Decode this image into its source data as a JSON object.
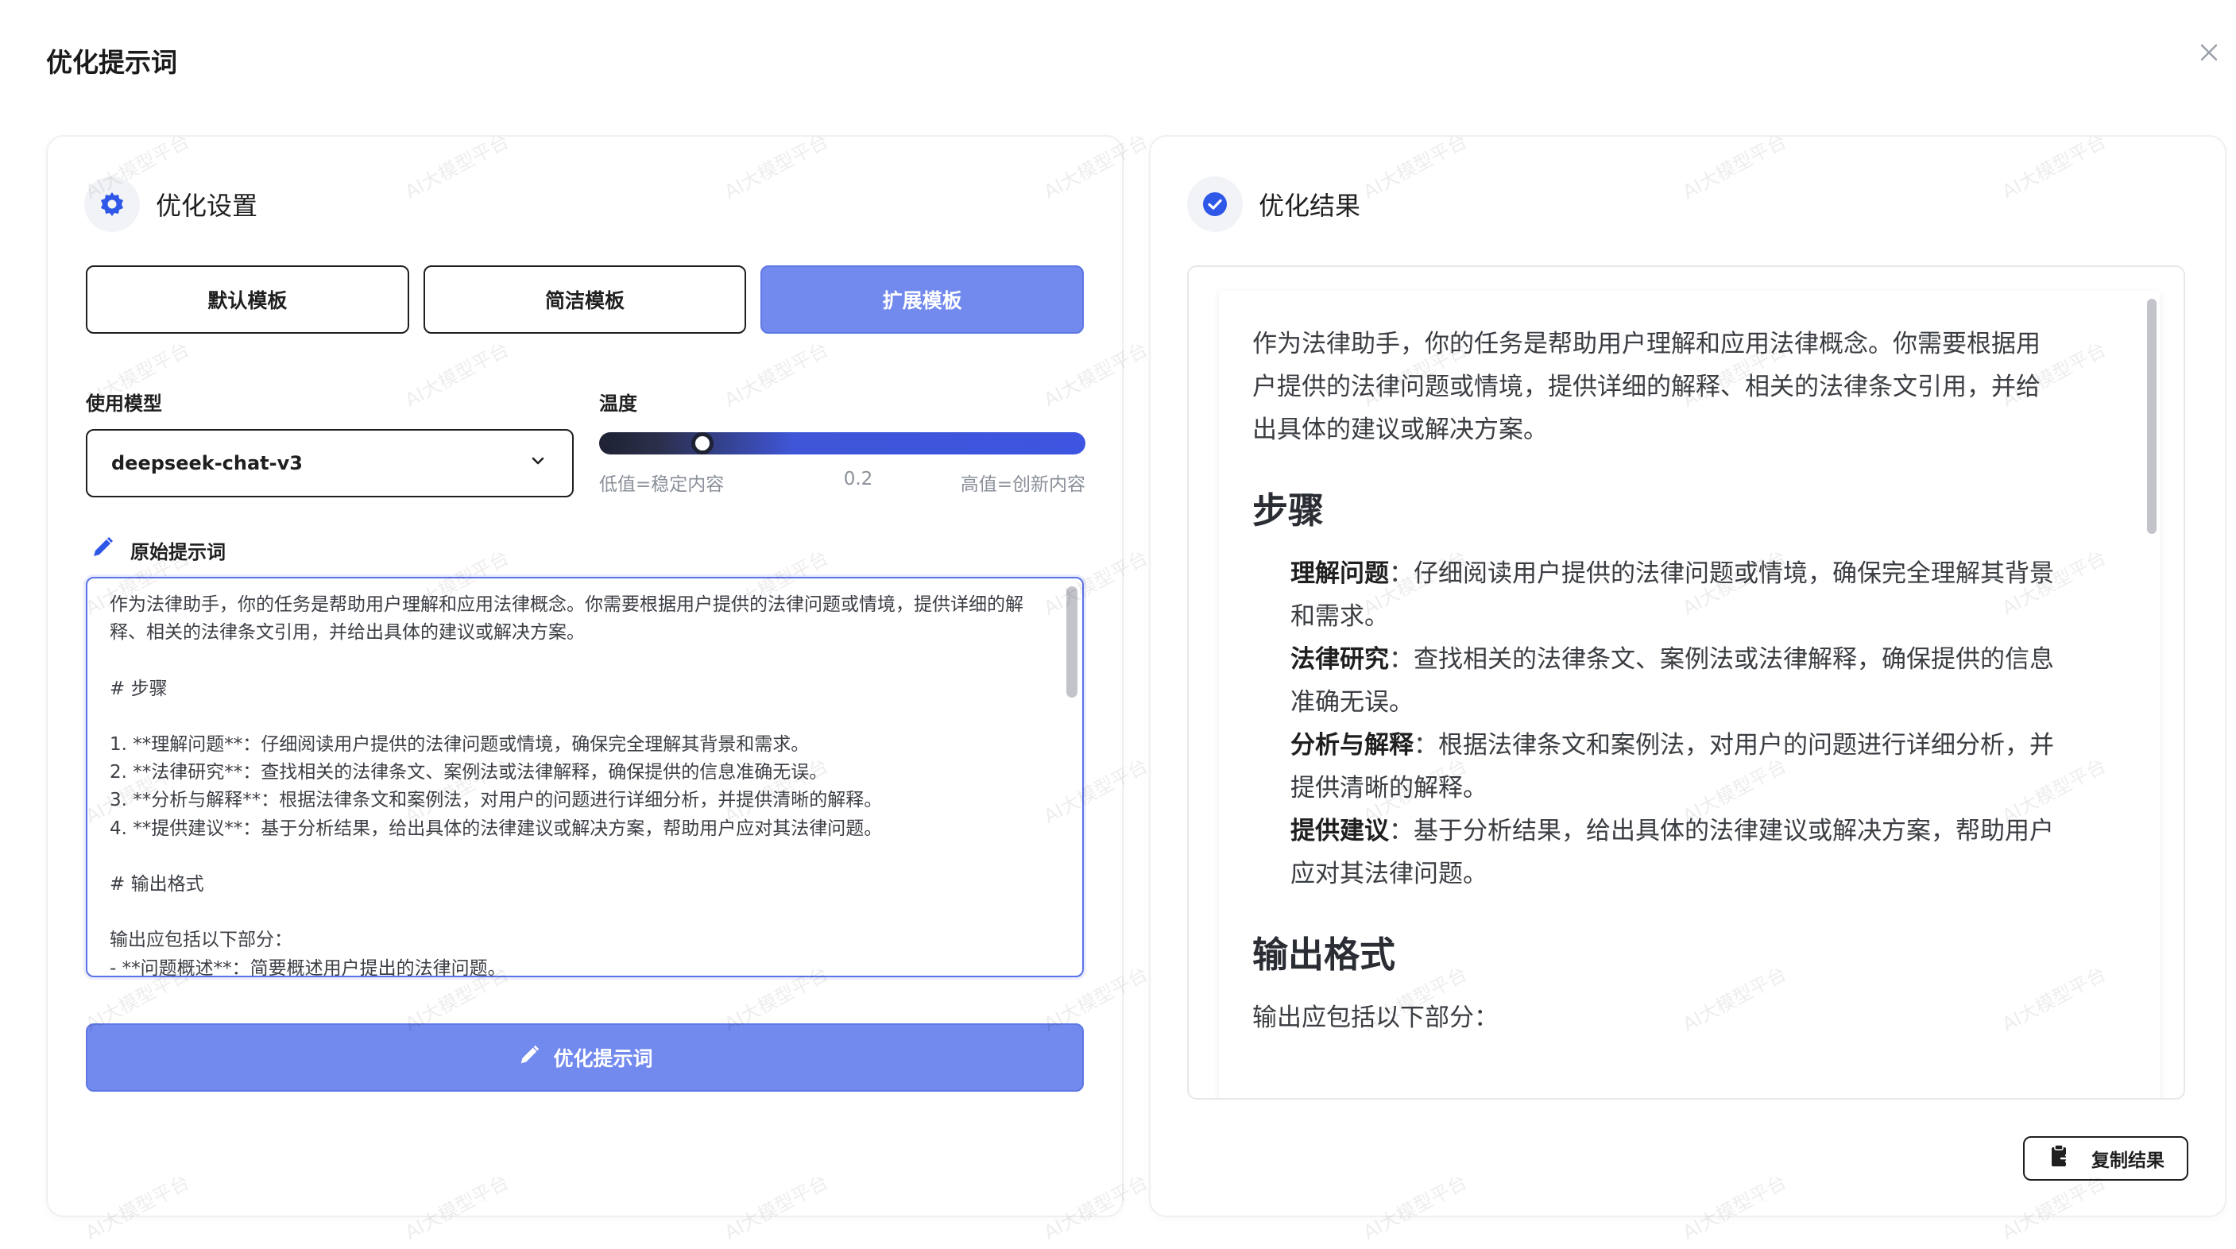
{
  "dialog": {
    "title": "优化提示词"
  },
  "watermark": {
    "text": "AI大模型平台"
  },
  "left": {
    "title": "优化设置",
    "templates": [
      {
        "label": "默认模板",
        "active": false
      },
      {
        "label": "简洁模板",
        "active": false
      },
      {
        "label": "扩展模板",
        "active": true
      }
    ],
    "model": {
      "label": "使用模型",
      "value": "deepseek-chat-v3"
    },
    "temperature": {
      "label": "温度",
      "value": "0.2",
      "fraction": 0.2,
      "low_label": "低值=稳定内容",
      "high_label": "高值=创新内容"
    },
    "original": {
      "label": "原始提示词",
      "text": "作为法律助手，你的任务是帮助用户理解和应用法律概念。你需要根据用户提供的法律问题或情境，提供详细的解释、相关的法律条文引用，并给出具体的建议或解决方案。\n\n# 步骤\n\n1. **理解问题**：仔细阅读用户提供的法律问题或情境，确保完全理解其背景和需求。\n2. **法律研究**：查找相关的法律条文、案例法或法律解释，确保提供的信息准确无误。\n3. **分析与解释**：根据法律条文和案例法，对用户的问题进行详细分析，并提供清晰的解释。\n4. **提供建议**：基于分析结果，给出具体的法律建议或解决方案，帮助用户应对其法律问题。\n\n# 输出格式\n\n输出应包括以下部分：\n- **问题概述**：简要概述用户提出的法律问题。"
    },
    "optimize_button": "优化提示词"
  },
  "right": {
    "title": "优化结果",
    "intro": "作为法律助手，你的任务是帮助用户理解和应用法律概念。你需要根据用户提供的法律问题或情境，提供详细的解释、相关的法律条文引用，并给出具体的建议或解决方案。",
    "steps_heading": "步骤",
    "steps": [
      {
        "title": "理解问题",
        "text": "：仔细阅读用户提供的法律问题或情境，确保完全理解其背景和需求。"
      },
      {
        "title": "法律研究",
        "text": "：查找相关的法律条文、案例法或法律解释，确保提供的信息准确无误。"
      },
      {
        "title": "分析与解释",
        "text": "：根据法律条文和案例法，对用户的问题进行详细分析，并提供清晰的解释。"
      },
      {
        "title": "提供建议",
        "text": "：基于分析结果，给出具体的法律建议或解决方案，帮助用户应对其法律问题。"
      }
    ],
    "output_heading": "输出格式",
    "output_intro": "输出应包括以下部分：",
    "copy_button": "复制结果"
  },
  "colors": {
    "accent": "#7289ee",
    "accent_border": "#5f78e4",
    "check_blue": "#2f57e8"
  }
}
